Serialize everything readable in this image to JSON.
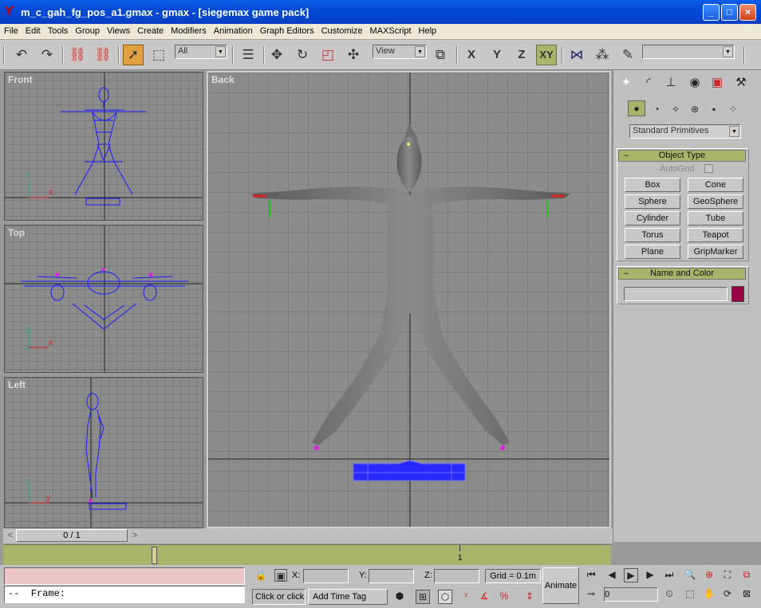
{
  "window": {
    "title": "m_c_gah_fg_pos_a1.gmax - gmax - [siegemax game pack]",
    "minimize_glyph": "_",
    "maximize_glyph": "□",
    "close_glyph": "×"
  },
  "menu": [
    "File",
    "Edit",
    "Tools",
    "Group",
    "Views",
    "Create",
    "Modifiers",
    "Animation",
    "Graph Editors",
    "Customize",
    "MAXScript",
    "Help"
  ],
  "toolbar": {
    "selection_filter": "All",
    "reference_coord": "View",
    "axis_x": "X",
    "axis_y": "Y",
    "axis_z": "Z",
    "axis_xy": "XY",
    "named_selection": ""
  },
  "viewports": {
    "front": "Front",
    "top": "Top",
    "left": "Left",
    "back": "Back"
  },
  "axis_labels": {
    "x": "x",
    "y": "y",
    "z": "z"
  },
  "command_panel": {
    "category": "Standard Primitives",
    "object_type_title": "Object Type",
    "autogrid_label": "AutoGrid",
    "buttons": [
      "Box",
      "Cone",
      "Sphere",
      "GeoSphere",
      "Cylinder",
      "Tube",
      "Torus",
      "Teapot",
      "Plane",
      "GripMarker"
    ],
    "name_color_title": "Name and Color",
    "object_name": "",
    "object_color": "#990044",
    "rollout_color": "#a8b46a"
  },
  "time_slider": {
    "frame_display": "0 / 1",
    "prev_glyph": "<",
    "next_glyph": ">"
  },
  "trackbar": {
    "tick_label": "1"
  },
  "status": {
    "maxscript_listener_line": "--  Frame:",
    "prompt": "Click or click-",
    "add_time_tag": "Add Time Tag",
    "x_label": "X:",
    "y_label": "Y:",
    "z_label": "Z:",
    "x_value": "",
    "y_value": "",
    "z_value": "",
    "grid": "Grid = 0.1m",
    "animate": "Animate",
    "current_frame": "0"
  },
  "colors": {
    "viewport_bg": "#8c8c8c",
    "wireframe": "#1a1aff",
    "selection_accent": "#e0a040"
  }
}
